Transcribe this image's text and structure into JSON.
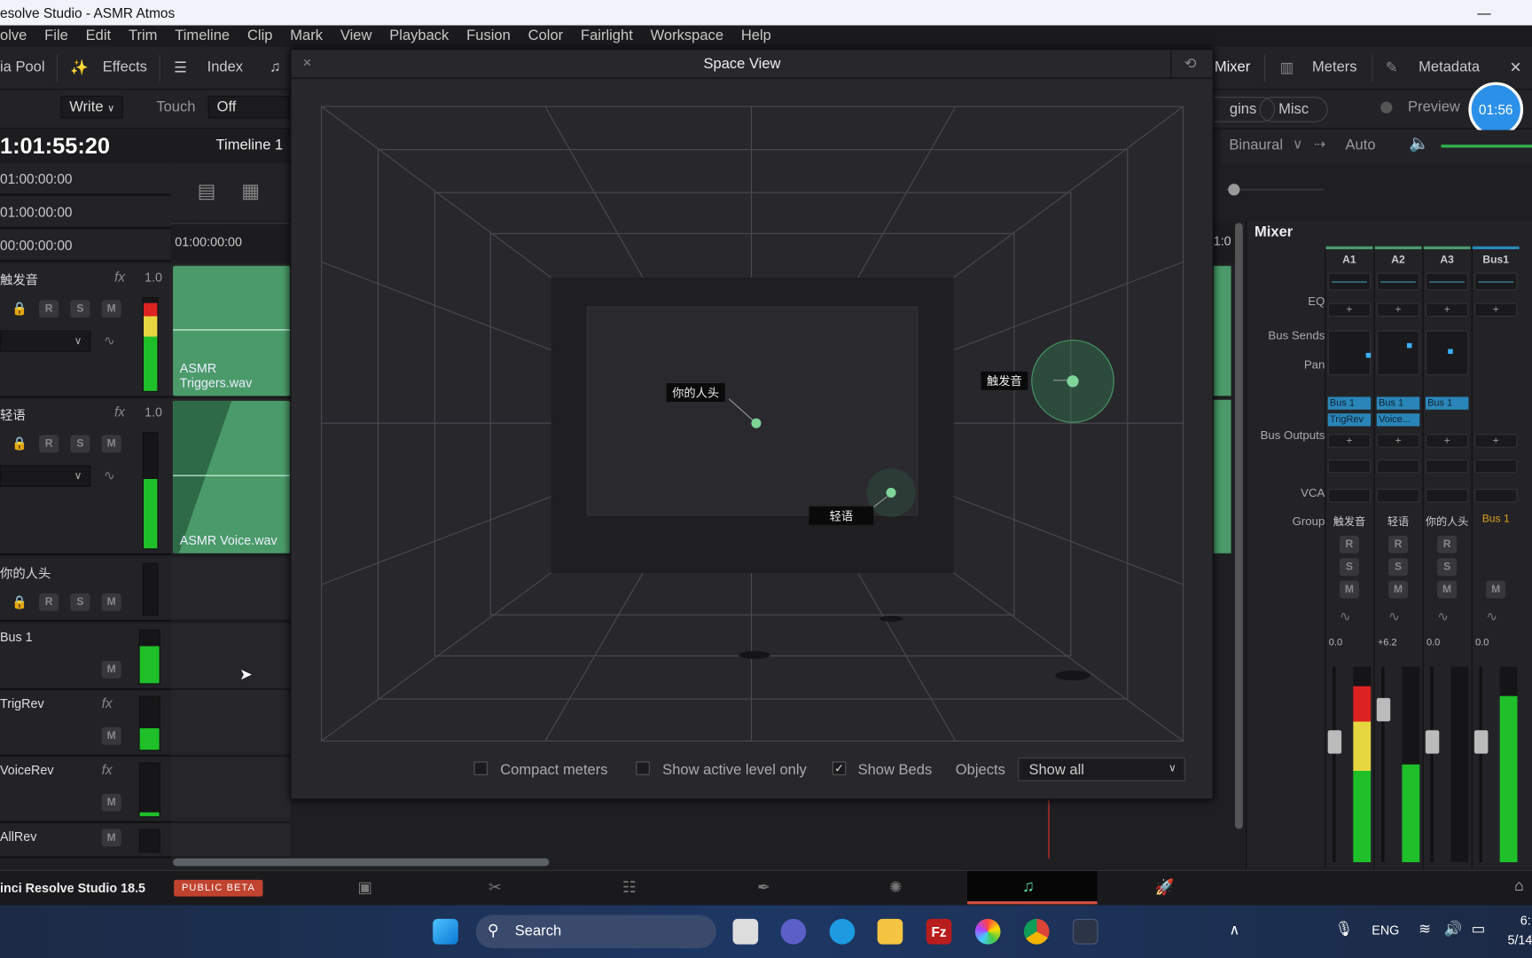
{
  "window": {
    "title": "esolve Studio - ASMR Atmos"
  },
  "menu": [
    "olve",
    "File",
    "Edit",
    "Trim",
    "Timeline",
    "Clip",
    "Mark",
    "View",
    "Playback",
    "Fusion",
    "Color",
    "Fairlight",
    "Workspace",
    "Help"
  ],
  "toolbar": {
    "media_pool": "ia Pool",
    "effects": "Effects",
    "index": "Index",
    "mixer": "Mixer",
    "meters": "Meters",
    "metadata": "Metadata"
  },
  "automation": {
    "write": "Write",
    "touch_label": "Touch",
    "touch_value": "Off"
  },
  "right_controls": {
    "plugins": "gins",
    "misc": "Misc",
    "preview": "Preview",
    "timer": "01:56",
    "binaural": "Binaural",
    "auto": "Auto"
  },
  "timecode": {
    "main": "1:01:55:20",
    "timeline_name": "Timeline 1",
    "rows": [
      "01:00:00:00",
      "01:00:00:00",
      "00:00:00:00"
    ],
    "ruler_start": "01:00:00:00",
    "ruler_right": "1:0"
  },
  "tracks": [
    {
      "name": "触发音",
      "fx": "fx",
      "level": "1.0",
      "clip": "ASMR Triggers.wav"
    },
    {
      "name": "轻语",
      "fx": "fx",
      "level": "1.0",
      "clip": "ASMR Voice.wav"
    },
    {
      "name": "你的人头"
    },
    {
      "name": "Bus 1"
    },
    {
      "name": "TrigRev",
      "fx": "fx"
    },
    {
      "name": "VoiceRev",
      "fx": "fx"
    },
    {
      "name": "AllRev"
    }
  ],
  "rsm": {
    "r": "R",
    "s": "S",
    "m": "M"
  },
  "space_view": {
    "title": "Space View",
    "close": "×",
    "objects": [
      {
        "name": "你的人头"
      },
      {
        "name": "触发音"
      },
      {
        "name": "轻语"
      }
    ],
    "compact_meters": {
      "label": "Compact meters",
      "checked": false
    },
    "active_level": {
      "label": "Show active level only",
      "checked": false
    },
    "show_beds": {
      "label": "Show Beds",
      "checked": true
    },
    "objects_label": "Objects",
    "objects_value": "Show all"
  },
  "mixer": {
    "title": "Mixer",
    "row_labels": {
      "eq": "EQ",
      "bus_sends": "Bus Sends",
      "pan": "Pan",
      "bus_outputs": "Bus Outputs",
      "vca": "VCA",
      "group": "Group"
    },
    "plus": "+",
    "channels": [
      {
        "id": "A1",
        "name": "触发音",
        "outputs": [
          "Bus 1",
          "TrigRev"
        ],
        "gain": "0.0",
        "meter": 0.9
      },
      {
        "id": "A2",
        "name": "轻语",
        "outputs": [
          "Bus 1",
          "Voice..."
        ],
        "gain": "+6.2",
        "meter": 0.5
      },
      {
        "id": "A3",
        "name": "你的人头",
        "outputs": [
          "Bus 1"
        ],
        "gain": "0.0",
        "meter": 0
      },
      {
        "id": "Bus1",
        "name": "Bus 1",
        "outputs": [],
        "gain": "0.0",
        "meter": 0.85
      }
    ]
  },
  "footer": {
    "app": "inci Resolve Studio 18.5",
    "badge": "PUBLIC BETA"
  },
  "taskbar": {
    "search": "Search",
    "lang": "ENG",
    "time": "6:",
    "date": "5/14"
  },
  "colors": {
    "accent": "#4a9a6a",
    "bus": "#2a86b8",
    "badge": "#c0432f",
    "playhead": "#e03a2a"
  }
}
